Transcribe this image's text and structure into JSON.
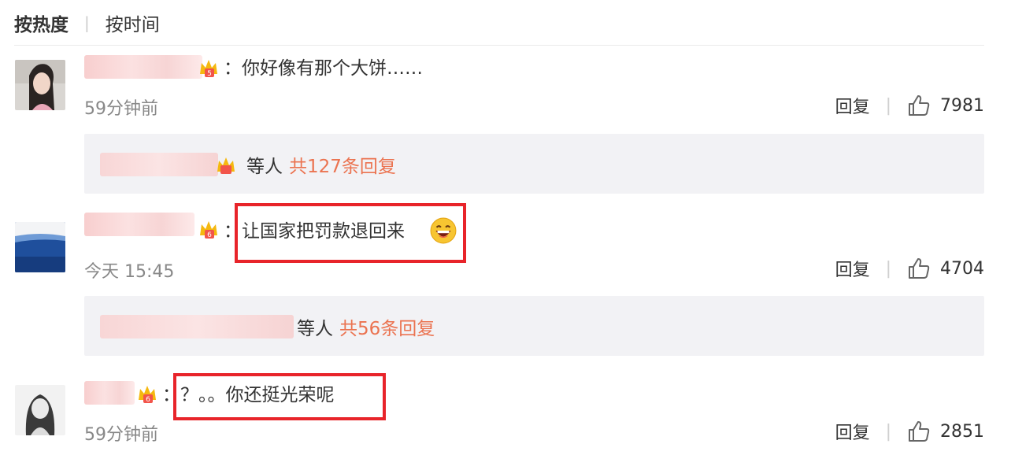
{
  "sort": {
    "hot_label": "按热度",
    "separator": "|",
    "time_label": "按时间"
  },
  "comments": [
    {
      "text": "：你好像有那个大饼……",
      "time": "59分钟前",
      "reply_label": "回复",
      "separator": "|",
      "likes": "7981",
      "replies_summary": {
        "etc": "等人",
        "count_label": "共127条回复"
      }
    },
    {
      "text": "：让国家把罚款退回来",
      "emoji": "laughing-emoji",
      "time": "今天 15:45",
      "reply_label": "回复",
      "separator": "|",
      "likes": "4704",
      "replies_summary": {
        "etc": "等人",
        "count_label": "共56条回复"
      }
    },
    {
      "text": "：？。。你还挺光荣呢",
      "time": "59分钟前",
      "reply_label": "回复",
      "separator": "|",
      "likes": "2851"
    }
  ],
  "colors": {
    "link_orange": "#eb7350",
    "highlight_red": "#e8242a",
    "reply_bg": "#f2f2f5",
    "muted_text": "#888888"
  }
}
